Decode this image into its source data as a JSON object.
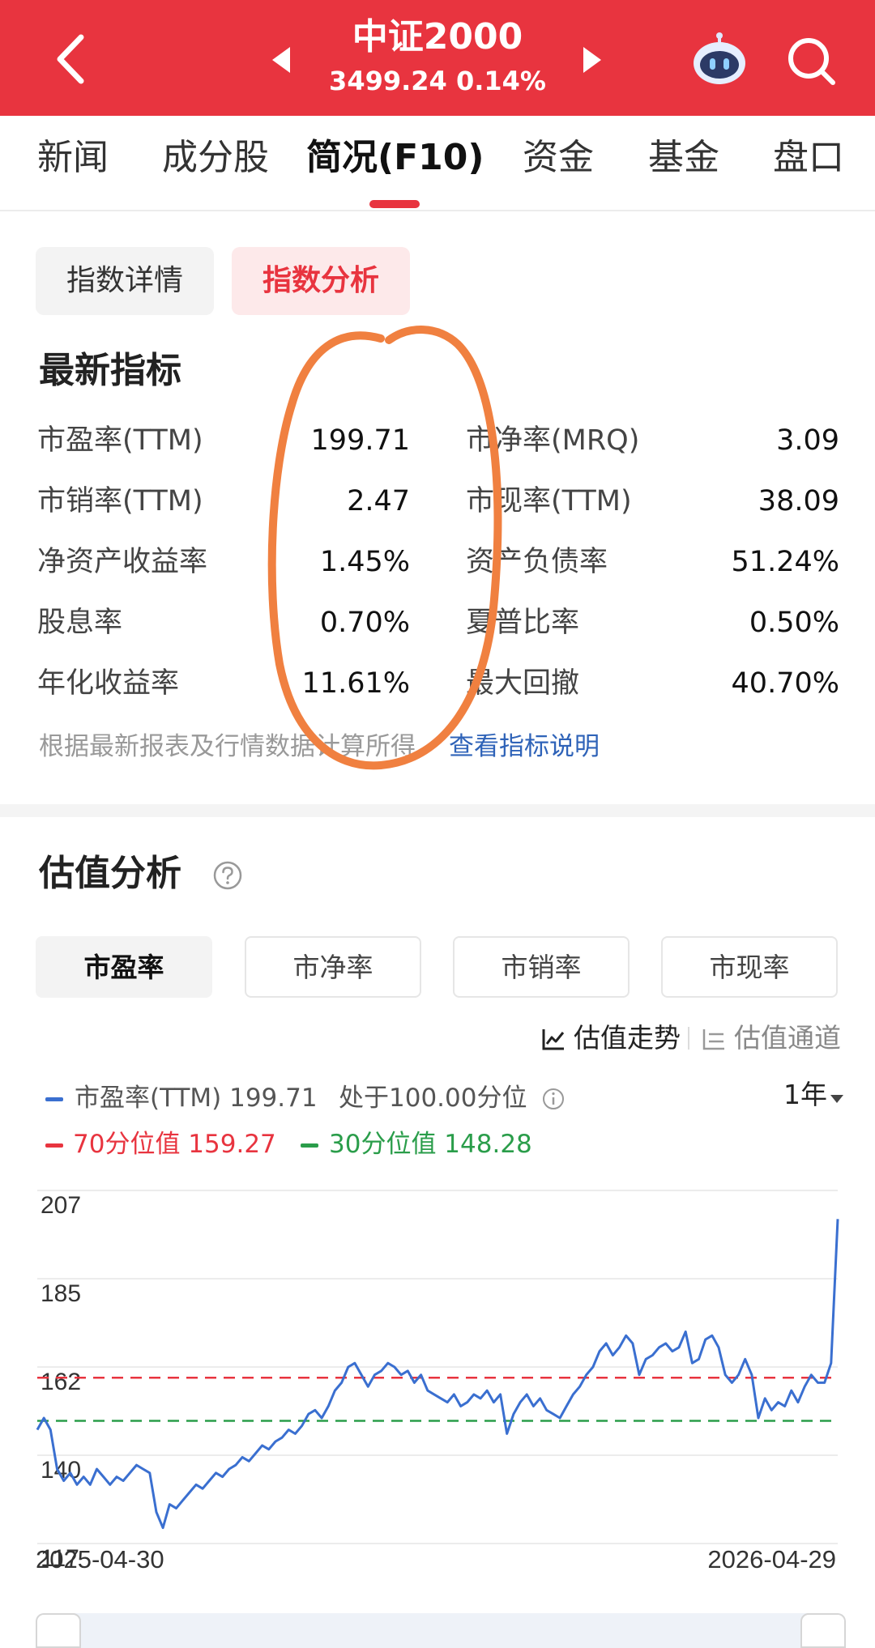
{
  "header": {
    "title": "中证2000",
    "subtitle": "3499.24 0.14%",
    "background_color": "#e8343f"
  },
  "tabs": [
    {
      "label": "新闻"
    },
    {
      "label": "成分股"
    },
    {
      "label": "简况(F10)",
      "active": true
    },
    {
      "label": "资金"
    },
    {
      "label": "基金"
    },
    {
      "label": "盘口"
    }
  ],
  "subtabs": {
    "detail": "指数详情",
    "analysis": "指数分析"
  },
  "metrics": {
    "title": "最新指标",
    "left": [
      {
        "label": "市盈率(TTM)",
        "value": "199.71"
      },
      {
        "label": "市销率(TTM)",
        "value": "2.47"
      },
      {
        "label": "净资产收益率",
        "value": "1.45%"
      },
      {
        "label": "股息率",
        "value": "0.70%"
      },
      {
        "label": "年化收益率",
        "value": "11.61%"
      }
    ],
    "right": [
      {
        "label": "市净率(MRQ)",
        "value": "3.09"
      },
      {
        "label": "市现率(TTM)",
        "value": "38.09"
      },
      {
        "label": "资产负债率",
        "value": "51.24%"
      },
      {
        "label": "夏普比率",
        "value": "0.50%"
      },
      {
        "label": "最大回撤",
        "value": "40.70%"
      }
    ],
    "note": "根据最新报表及行情数据计算所得",
    "note_link": "查看指标说明"
  },
  "valuation": {
    "title": "估值分析",
    "buttons": [
      "市盈率",
      "市净率",
      "市销率",
      "市现率"
    ],
    "active_button": "市盈率",
    "trend_label": "估值走势",
    "channel_label": "估值通道",
    "period": "1年",
    "legend": {
      "main": "市盈率(TTM) 199.71",
      "position": "处于100.00分位",
      "p70": "70分位值 159.27",
      "p30": "30分位值 148.28"
    }
  },
  "chart_data": {
    "type": "line",
    "y_ticks": [
      "207",
      "185",
      "162",
      "140",
      "117"
    ],
    "ylim": [
      117,
      207
    ],
    "x_start_label": "2025-04-30",
    "x_end_label": "2026-04-29",
    "series": [
      {
        "name": "市盈率(TTM)",
        "color": "#3a6fd0",
        "values": [
          146,
          149,
          146,
          136,
          133,
          135,
          132,
          134,
          132,
          136,
          134,
          132,
          134,
          133,
          135,
          137,
          136,
          135,
          125,
          121,
          127,
          126,
          128,
          130,
          132,
          131,
          133,
          135,
          134,
          136,
          137,
          139,
          138,
          140,
          142,
          141,
          143,
          144,
          146,
          145,
          147,
          150,
          151,
          149,
          152,
          156,
          158,
          162,
          163,
          160,
          157,
          160,
          161,
          163,
          162,
          160,
          161,
          158,
          160,
          156,
          155,
          154,
          153,
          155,
          152,
          153,
          155,
          154,
          156,
          153,
          155,
          145,
          150,
          153,
          155,
          152,
          154,
          151,
          150,
          149,
          152,
          155,
          157,
          160,
          162,
          166,
          168,
          165,
          167,
          170,
          168,
          160,
          164,
          165,
          167,
          168,
          166,
          167,
          171,
          163,
          164,
          169,
          170,
          167,
          160,
          158,
          160,
          164,
          160,
          149,
          154,
          151,
          153,
          152,
          156,
          153,
          157,
          160,
          158,
          158,
          163,
          199.71
        ]
      }
    ],
    "reference_lines": [
      {
        "name": "70分位值",
        "value": 159.27,
        "color": "#e8343f"
      },
      {
        "name": "30分位值",
        "value": 148.28,
        "color": "#2a9d4a"
      }
    ]
  }
}
